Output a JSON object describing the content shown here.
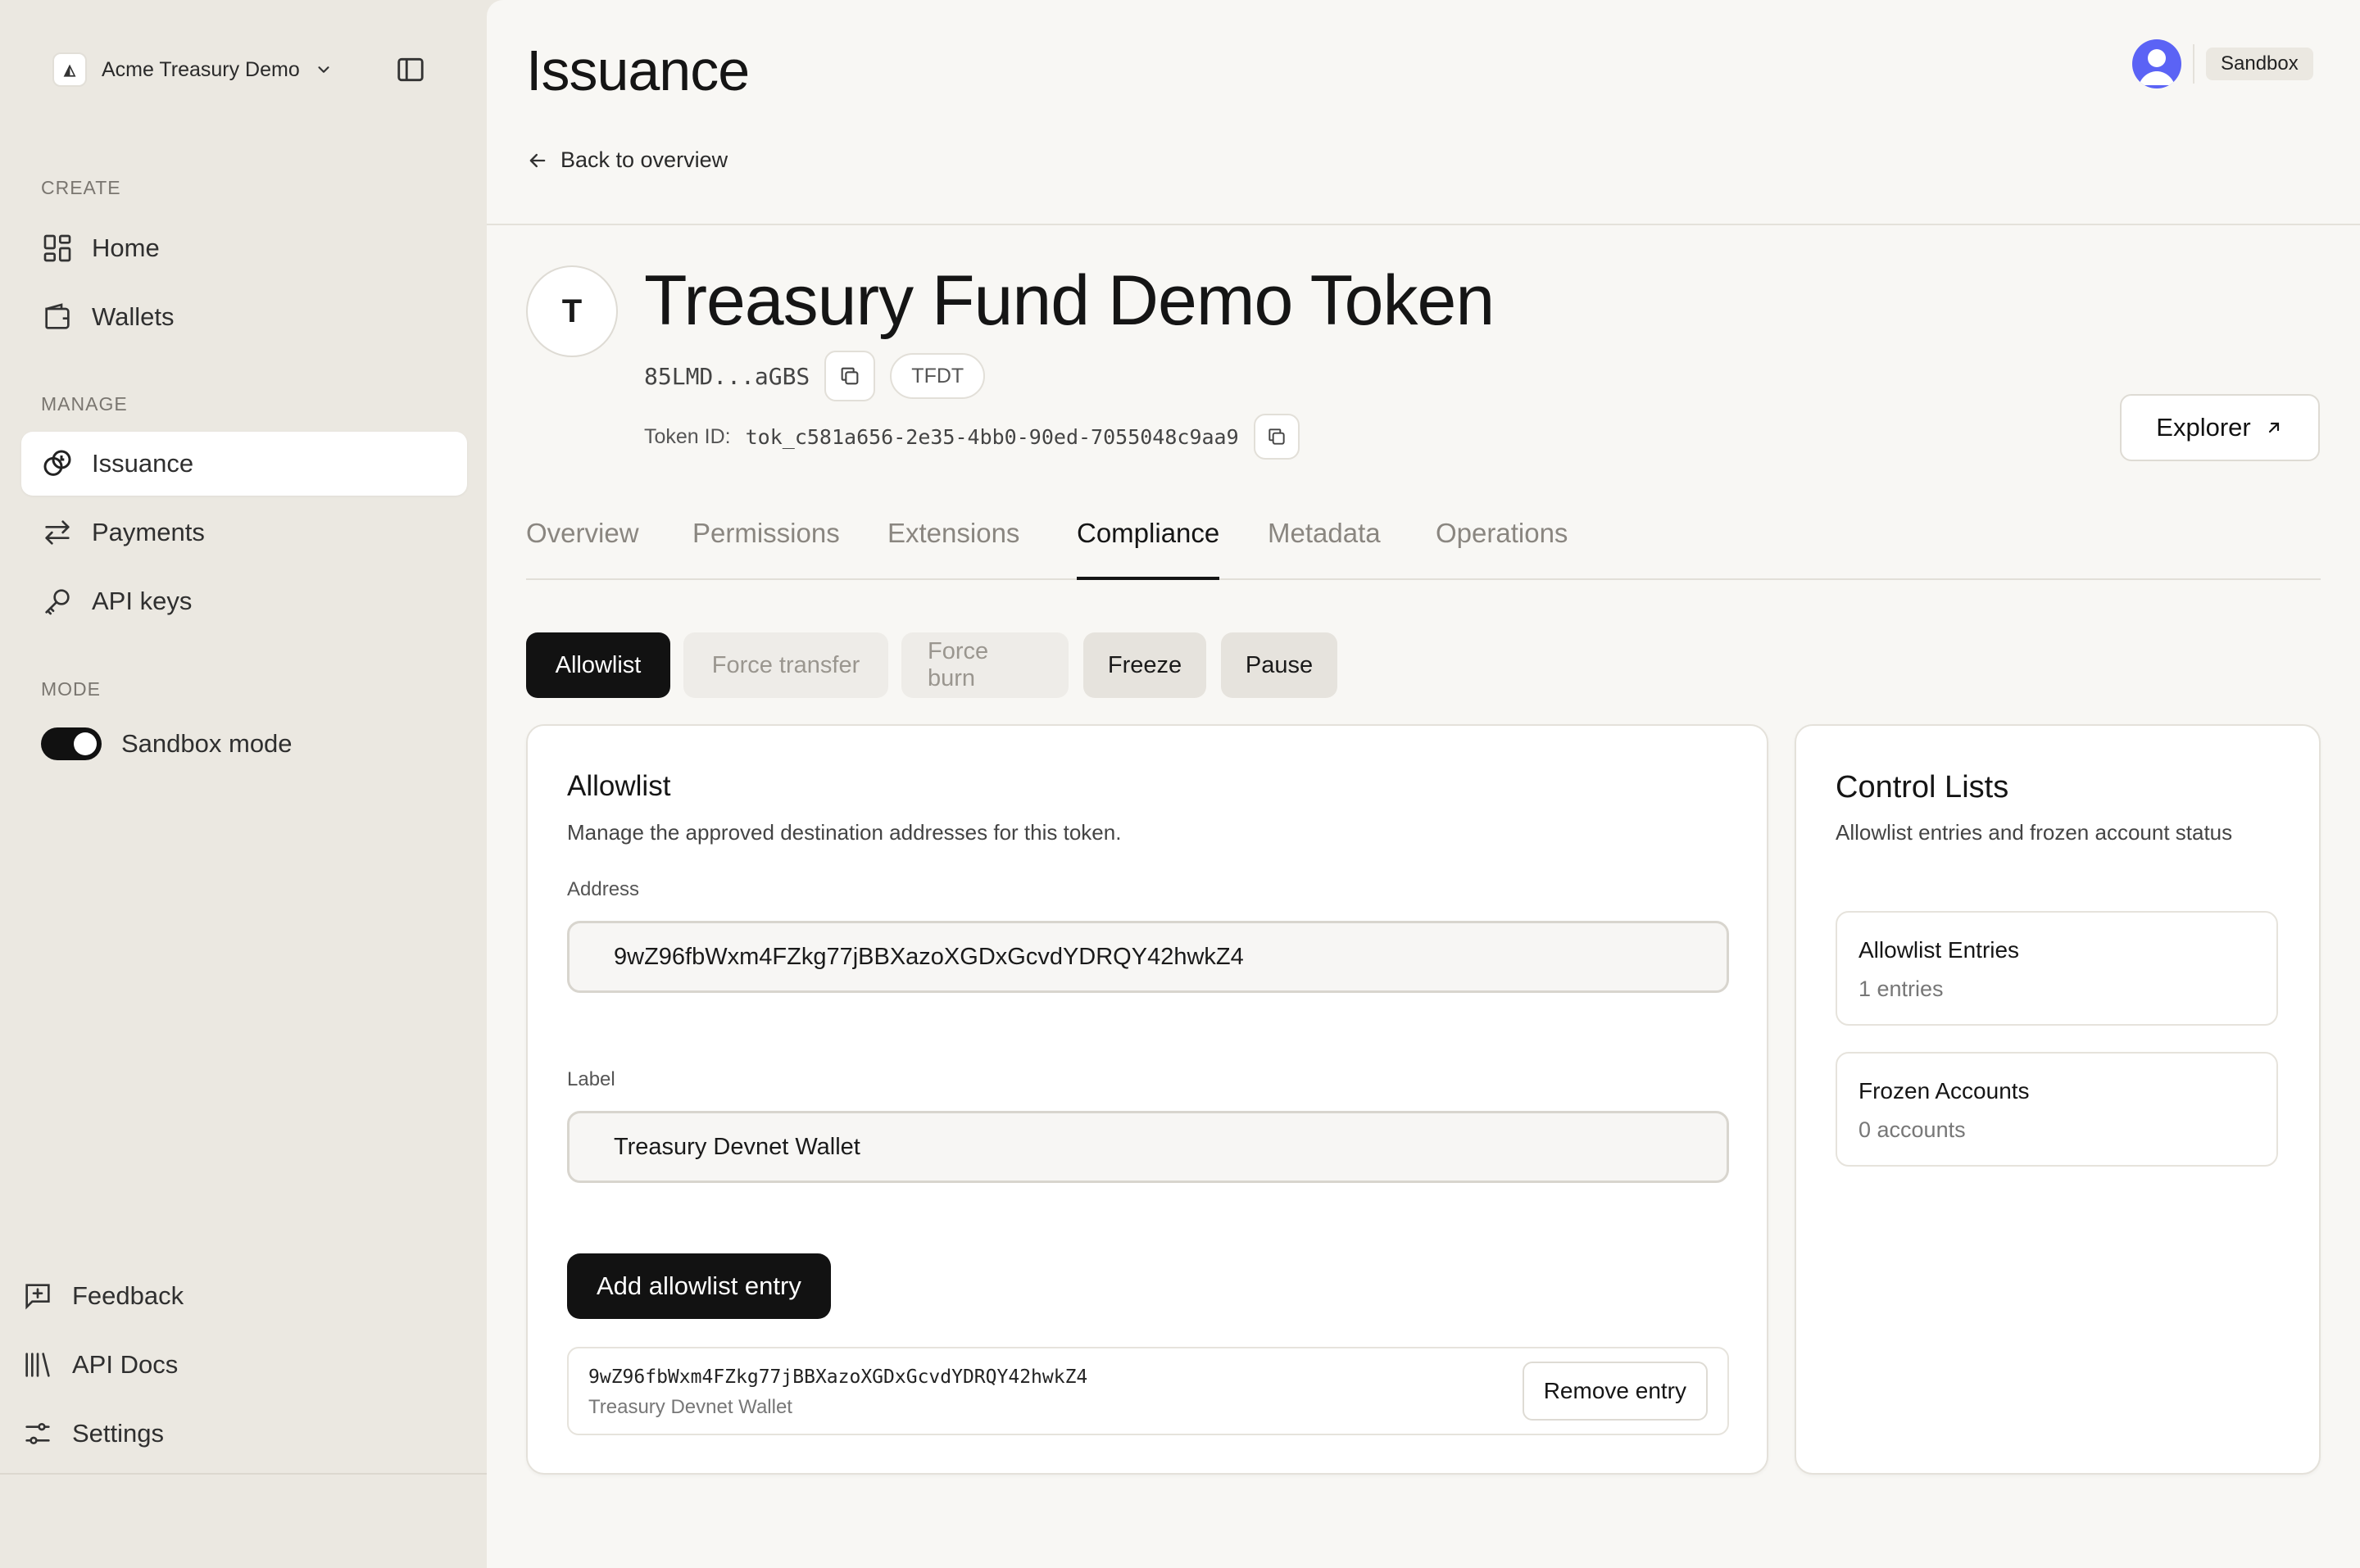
{
  "workspace": {
    "logo_glyph": "◭",
    "name": "Acme Treasury Demo"
  },
  "sidebar": {
    "sections": {
      "create": "CREATE",
      "manage": "MANAGE",
      "mode": "MODE"
    },
    "items": [
      {
        "label": "Home",
        "icon": "grid-icon"
      },
      {
        "label": "Wallets",
        "icon": "wallet-icon"
      },
      {
        "label": "Issuance",
        "icon": "issuance-icon",
        "active": true
      },
      {
        "label": "Payments",
        "icon": "arrows-icon"
      },
      {
        "label": "API keys",
        "icon": "key-icon"
      }
    ],
    "sandbox_toggle": {
      "label": "Sandbox mode",
      "on": true
    },
    "bottom": [
      {
        "label": "Feedback",
        "icon": "feedback-icon"
      },
      {
        "label": "API Docs",
        "icon": "library-icon"
      },
      {
        "label": "Settings",
        "icon": "sliders-icon"
      }
    ]
  },
  "header": {
    "title": "Issuance",
    "back_label": "Back to overview",
    "env_badge": "Sandbox"
  },
  "token": {
    "avatar_letter": "T",
    "name": "Treasury Fund Demo Token",
    "address_short": "85LMD...aGBS",
    "symbol": "TFDT",
    "id_label": "Token ID:",
    "id_value": "tok_c581a656-2e35-4bb0-90ed-7055048c9aa9",
    "explorer_label": "Explorer"
  },
  "tabs": [
    "Overview",
    "Permissions",
    "Extensions",
    "Compliance",
    "Metadata",
    "Operations"
  ],
  "active_tab": "Compliance",
  "compliance_actions": [
    {
      "label": "Allowlist",
      "state": "active"
    },
    {
      "label": "Force transfer",
      "state": "disabled"
    },
    {
      "label": "Force burn",
      "state": "disabled"
    },
    {
      "label": "Freeze",
      "state": "normal"
    },
    {
      "label": "Pause",
      "state": "normal"
    }
  ],
  "allowlist": {
    "title": "Allowlist",
    "description": "Manage the approved destination addresses for this token.",
    "address_label": "Address",
    "address_value": "9wZ96fbWxm4FZkg77jBBXazoXGDxGcvdYDRQY42hwkZ4",
    "label_label": "Label",
    "label_value": "Treasury Devnet Wallet",
    "add_button": "Add allowlist entry",
    "entries": [
      {
        "address": "9wZ96fbWxm4FZkg77jBBXazoXGDxGcvdYDRQY42hwkZ4",
        "label": "Treasury Devnet Wallet",
        "remove_label": "Remove entry"
      }
    ]
  },
  "control_lists": {
    "title": "Control Lists",
    "description": "Allowlist entries and frozen account status",
    "allowlist_entries": {
      "title": "Allowlist Entries",
      "value": "1 entries"
    },
    "frozen_accounts": {
      "title": "Frozen Accounts",
      "value": "0 accounts"
    }
  },
  "colors": {
    "accent": "#121212",
    "avatar": "#5b63f5",
    "sidebar_bg": "#ebe8e1",
    "main_bg": "#f8f7f4"
  }
}
